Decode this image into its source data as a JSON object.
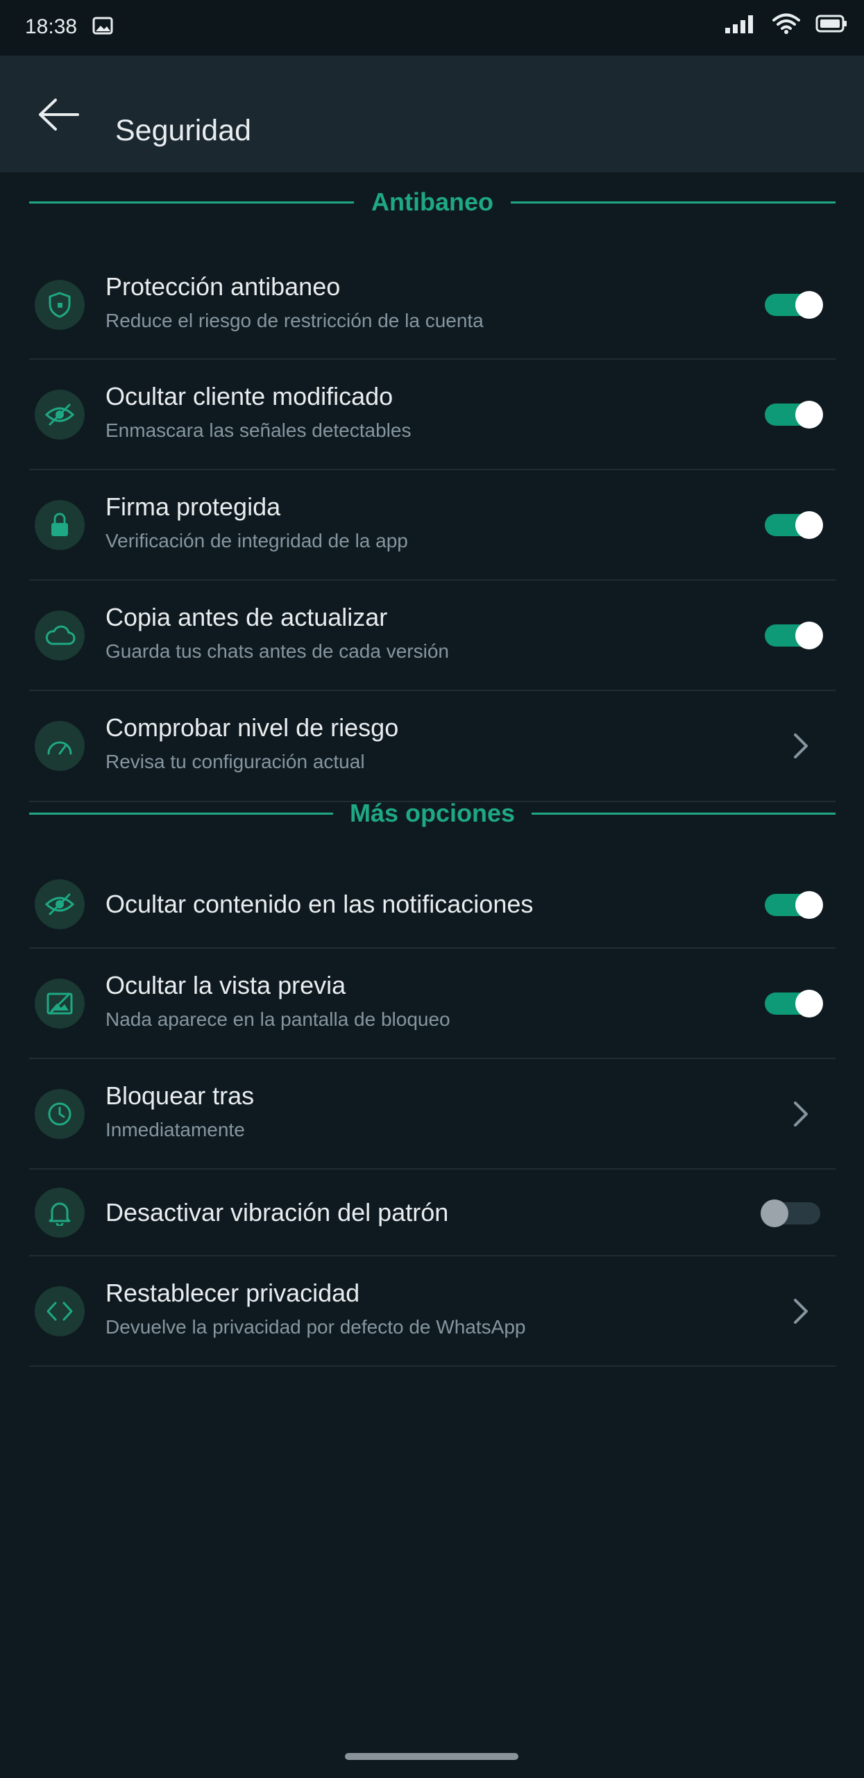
{
  "status_bar": {
    "time": "18:38"
  },
  "header": {
    "title": "Seguridad"
  },
  "sections": {
    "antibaneo": {
      "title": "Antibaneo"
    },
    "mas": {
      "title": "Más opciones"
    }
  },
  "rows": [
    {
      "title": "Protección antibaneo",
      "subtitle": "Reduce el riesgo de restricción de la cuenta",
      "icon": "shield-icon",
      "control": "toggle",
      "enabled": true
    },
    {
      "title": "Ocultar cliente modificado",
      "subtitle": "Enmascara las señales detectables",
      "icon": "eye-off-icon",
      "control": "toggle",
      "enabled": true
    },
    {
      "title": "Firma protegida",
      "subtitle": "Verificación de integridad de la app",
      "icon": "lock-icon",
      "control": "toggle",
      "enabled": true
    },
    {
      "title": "Copia antes de actualizar",
      "subtitle": "Guarda tus chats antes de cada versión",
      "icon": "cloud-icon",
      "control": "toggle",
      "enabled": true
    },
    {
      "title": "Comprobar nivel de riesgo",
      "subtitle": "Revisa tu configuración actual",
      "icon": "gauge-icon",
      "control": "chevron"
    },
    {
      "title": "Ocultar contenido en las notificaciones",
      "subtitle": "",
      "icon": "eye-off-icon",
      "control": "toggle",
      "enabled": true
    },
    {
      "title": "Ocultar la vista previa",
      "subtitle": "Nada aparece en la pantalla de bloqueo",
      "icon": "image-off-icon",
      "control": "toggle",
      "enabled": true
    },
    {
      "title": "Bloquear tras",
      "subtitle": "Inmediatamente",
      "icon": "clock-icon",
      "control": "chevron"
    },
    {
      "title": "Desactivar vibración del patrón",
      "subtitle": "",
      "icon": "bell-icon",
      "control": "toggle",
      "enabled": false
    },
    {
      "title": "Restablecer privacidad",
      "subtitle": "Devuelve la privacidad por defecto de WhatsApp",
      "icon": "code-icon",
      "control": "chevron"
    }
  ],
  "colors": {
    "accent": "#1fa884",
    "background": "#0f1a20",
    "app_bar": "#1b2830",
    "toggle_on": "#0e9a76"
  }
}
